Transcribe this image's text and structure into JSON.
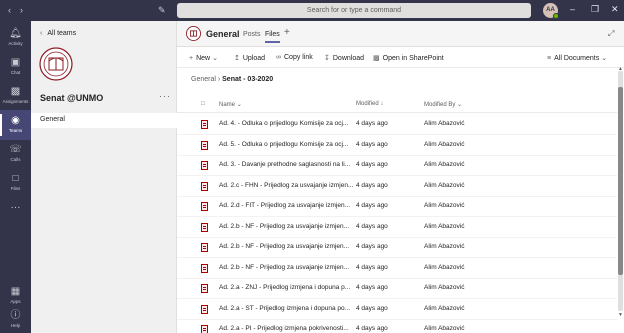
{
  "search": {
    "placeholder": "Search for or type a command"
  },
  "user": {
    "initials": "AA"
  },
  "rail": [
    {
      "label": "Activity",
      "icon": "bell-icon"
    },
    {
      "label": "Chat",
      "icon": "chat-icon"
    },
    {
      "label": "Assignments",
      "icon": "assignments-icon"
    },
    {
      "label": "Teams",
      "icon": "teams-icon"
    },
    {
      "label": "Calls",
      "icon": "phone-icon"
    },
    {
      "label": "Files",
      "icon": "file-icon"
    },
    {
      "label": "Apps",
      "icon": "apps-icon"
    },
    {
      "label": "Help",
      "icon": "help-icon"
    }
  ],
  "team": {
    "back_label": "All teams",
    "name": "Senat @UNMO",
    "channels": [
      "General"
    ]
  },
  "header": {
    "channel": "General",
    "tabs": [
      "Posts",
      "Files"
    ],
    "active_tab": "Files"
  },
  "toolbar": {
    "new": "New",
    "upload": "Upload",
    "copy_link": "Copy link",
    "download": "Download",
    "open_sharepoint": "Open in SharePoint",
    "view": "All Documents"
  },
  "breadcrumb": {
    "root": "General",
    "current": "Senat - 03-2020"
  },
  "columns": {
    "name": "Name",
    "modified": "Modified",
    "modified_by": "Modified By"
  },
  "files": [
    {
      "name": "Ad. 4. - Odluka o prijedlogu Komisije za ocj...",
      "modified": "4 days ago",
      "modified_by": "Alim Abazović"
    },
    {
      "name": "Ad. 5. - Odluka o prijedlogu Komisije za ocj...",
      "modified": "4 days ago",
      "modified_by": "Alim Abazović"
    },
    {
      "name": "Ad. 3. - Davanje prethodne saglasnosti na li...",
      "modified": "4 days ago",
      "modified_by": "Alim Abazović"
    },
    {
      "name": "Ad. 2.c - FHN - Prijedlog za usvajanje izmjen...",
      "modified": "4 days ago",
      "modified_by": "Alim Abazović"
    },
    {
      "name": "Ad. 2.d - FIT - Prijedlog za usvajanje izmjen...",
      "modified": "4 days ago",
      "modified_by": "Alim Abazović"
    },
    {
      "name": "Ad. 2.b - NF - Prijedlog za usvajanje izmjen...",
      "modified": "4 days ago",
      "modified_by": "Alim Abazović"
    },
    {
      "name": "Ad. 2.b - NF - Prijedlog za usvajanje izmjen...",
      "modified": "4 days ago",
      "modified_by": "Alim Abazović"
    },
    {
      "name": "Ad. 2.b - NF - Prijedlog za usvajanje izmjen...",
      "modified": "4 days ago",
      "modified_by": "Alim Abazović"
    },
    {
      "name": "Ad. 2.a - ZNJ - Prijedlog izmjena i dopuna p...",
      "modified": "4 days ago",
      "modified_by": "Alim Abazović"
    },
    {
      "name": "Ad. 2.a - ST - Prijedlog izmjena i dopuna po...",
      "modified": "4 days ago",
      "modified_by": "Alim Abazović"
    },
    {
      "name": "Ad. 2.a - PI - Prijedlog izmjena pokrivenosti...",
      "modified": "4 days ago",
      "modified_by": "Alim Abazović"
    }
  ],
  "colors": {
    "rail": "#33344a",
    "accent": "#6264a7",
    "pdf": "#a80000"
  }
}
